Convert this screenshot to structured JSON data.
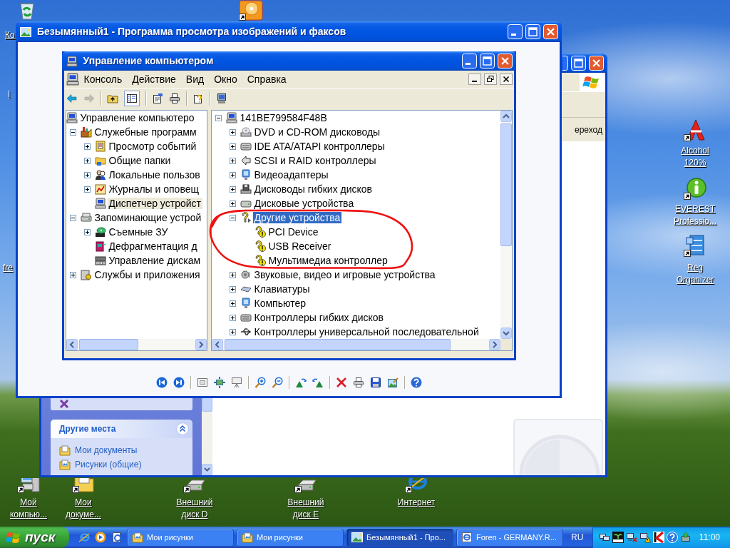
{
  "desktop_icons": [
    {
      "label": "Ко"
    },
    {
      "label": "I"
    },
    {
      "label": "fre"
    },
    {
      "label": "Alcohol 120%"
    },
    {
      "label": "EVEREST Professio..."
    },
    {
      "label": "Reg Organizer"
    },
    {
      "label": "Мой компью..."
    },
    {
      "label": "Мои докуме..."
    },
    {
      "label": "Внешний диск D"
    },
    {
      "label": "Внешний диск E"
    },
    {
      "label": "Интернет"
    }
  ],
  "explorer_window": {
    "go_button": "ереход",
    "task_pane": {
      "title": "Другие места",
      "expanded": true,
      "links": [
        "Мои документы",
        "Рисунки (общие)"
      ]
    }
  },
  "viewer_window": {
    "title": "Безымянный1 - Программа просмотра изображений и факсов"
  },
  "screenshot": {
    "title": "Управление компьютером",
    "menu": [
      "Консоль",
      "Действие",
      "Вид",
      "Окно",
      "Справка"
    ],
    "toolbar": [
      {
        "pressed": false,
        "disabled": false
      },
      {
        "pressed": false,
        "disabled": true
      },
      {
        "pressed": false,
        "disabled": false
      },
      {
        "pressed": true,
        "disabled": false
      },
      {
        "pressed": false,
        "disabled": false
      },
      {
        "pressed": false,
        "disabled": false
      },
      {
        "pressed": false,
        "disabled": false
      },
      {
        "pressed": false,
        "disabled": false
      }
    ],
    "left_pane": {
      "focused": false,
      "tree": [
        {
          "label": "Управление компьютеро",
          "selected": false,
          "children": [
            {
              "label": "Служебные программ",
              "selected": false,
              "expanded": true,
              "children": [
                {
                  "label": "Просмотр событий",
                  "selected": false,
                  "expanded": false
                },
                {
                  "label": "Общие папки",
                  "selected": false,
                  "expanded": false
                },
                {
                  "label": "Локальные пользов",
                  "selected": false,
                  "expanded": false
                },
                {
                  "label": "Журналы и оповещ",
                  "selected": false,
                  "expanded": false
                },
                {
                  "label": "Диспетчер устройст",
                  "selected": true
                }
              ]
            },
            {
              "label": "Запоминающие устрой",
              "selected": false,
              "expanded": true,
              "children": [
                {
                  "label": "Съемные ЗУ",
                  "selected": false,
                  "expanded": false
                },
                {
                  "label": "Дефрагментация д",
                  "selected": false
                },
                {
                  "label": "Управление дискам",
                  "selected": false
                }
              ]
            },
            {
              "label": "Службы и приложения",
              "selected": false,
              "expanded": false
            }
          ]
        }
      ]
    },
    "right_pane": {
      "focused": true,
      "tree": [
        {
          "label": "141BE799584F48B",
          "selected": false,
          "expanded": true,
          "children": [
            {
              "label": "DVD и CD-ROM дисководы",
              "selected": false,
              "expanded": false
            },
            {
              "label": "IDE ATA/ATAPI контроллеры",
              "selected": false,
              "expanded": false
            },
            {
              "label": "SCSI и RAID контроллеры",
              "selected": false,
              "expanded": false
            },
            {
              "label": "Видеоадаптеры",
              "selected": false,
              "expanded": false
            },
            {
              "label": "Дисководы гибких дисков",
              "selected": false,
              "expanded": false
            },
            {
              "label": "Дисковые устройства",
              "selected": false,
              "expanded": false
            },
            {
              "label": "Другие устройства",
              "selected": true,
              "expanded": true,
              "children": [
                {
                  "label": "PCI Device",
                  "selected": false
                },
                {
                  "label": "USB Receiver",
                  "selected": false
                },
                {
                  "label": "Мультимедиа контроллер",
                  "selected": false
                }
              ]
            },
            {
              "label": "Звуковые, видео и игровые устройства",
              "selected": false,
              "expanded": false
            },
            {
              "label": "Клавиатуры",
              "selected": false,
              "expanded": false
            },
            {
              "label": "Компьютер",
              "selected": false,
              "expanded": false
            },
            {
              "label": "Контроллеры гибких дисков",
              "selected": false,
              "expanded": false
            },
            {
              "label": "Контроллеры универсальной последовательной",
              "selected": false,
              "expanded": false
            }
          ]
        }
      ]
    }
  },
  "taskbar": {
    "start_button": "пуск",
    "tasks": [
      {
        "label": "Мои рисунки",
        "selected": false
      },
      {
        "label": "Мои рисунки",
        "selected": false
      },
      {
        "label": "Безымянный1 - Про...",
        "selected": true
      },
      {
        "label": "Foren - GERMANY.R...",
        "selected": false
      }
    ],
    "language": "RU",
    "clock": "11:00"
  }
}
